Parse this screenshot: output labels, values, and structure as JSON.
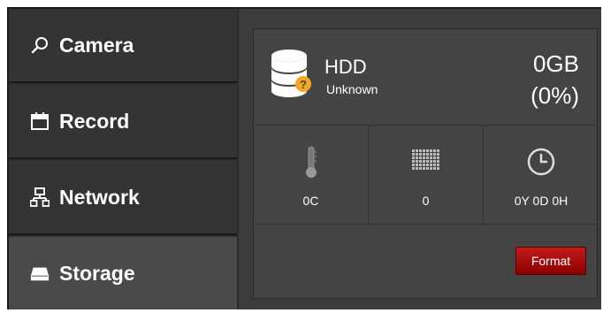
{
  "sidebar": {
    "items": [
      {
        "label": "Camera",
        "icon": "search-icon"
      },
      {
        "label": "Record",
        "icon": "calendar-icon"
      },
      {
        "label": "Network",
        "icon": "network-icon"
      },
      {
        "label": "Storage",
        "icon": "drive-icon",
        "active": true
      }
    ]
  },
  "storage": {
    "disk_name": "HDD",
    "disk_status": "Unknown",
    "disk_size": "0GB",
    "disk_percent": "(0%)",
    "temperature": "0C",
    "bad_sectors": "0",
    "uptime": "0Y 0D 0H",
    "format_label": "Format"
  },
  "colors": {
    "accent_red": "#a00000",
    "warning_orange": "#f5a623",
    "background": "#2d2d2d"
  }
}
